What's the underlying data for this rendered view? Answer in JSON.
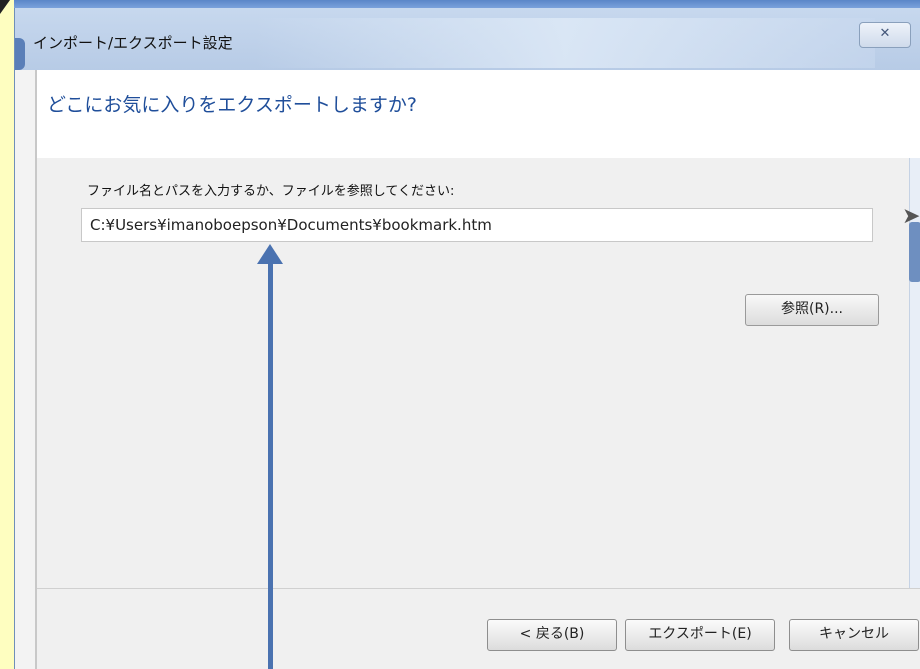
{
  "window": {
    "title": "インポート/エクスポート設定",
    "close_symbol": "✕"
  },
  "header": {
    "title": "どこにお気に入りをエクスポートしますか?"
  },
  "form": {
    "prompt": "ファイル名とパスを入力するか、ファイルを参照してください:",
    "path_value": "C:¥Users¥imanoboepson¥Documents¥bookmark.htm",
    "browse_label": "参照(R)..."
  },
  "footer": {
    "back_label": "< 戻る(B)",
    "export_label": "エクスポート(E)",
    "cancel_label": "キャンセル"
  },
  "colors": {
    "accent": "#1f4e9a",
    "annotation_arrow": "#4a72b0"
  }
}
